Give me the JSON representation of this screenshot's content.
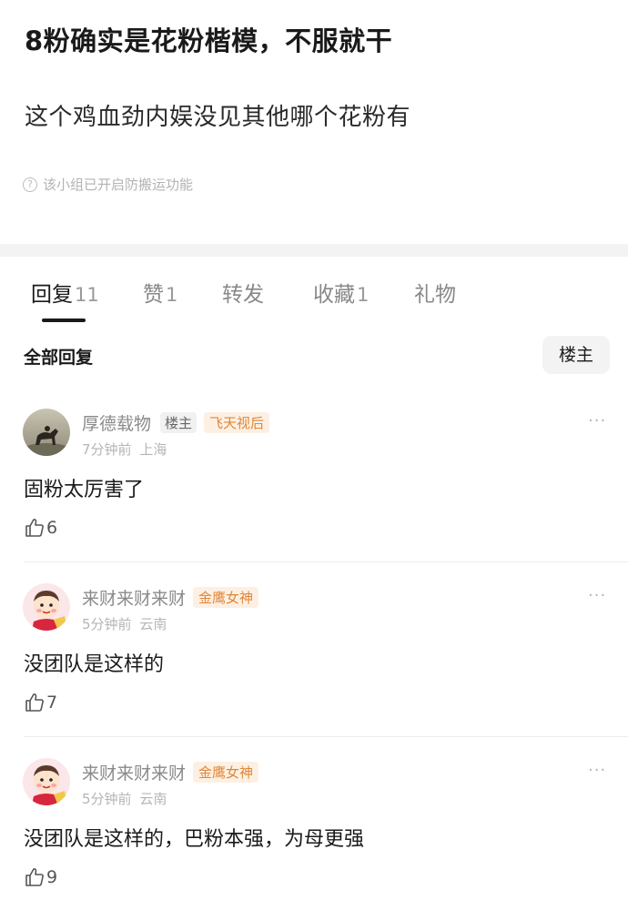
{
  "post": {
    "title": "8粉确实是花粉楷模，不服就干",
    "body": "这个鸡血劲内娱没见其他哪个花粉有",
    "notice": "该小组已开启防搬运功能"
  },
  "tabs": [
    {
      "label": "回复",
      "count": "11"
    },
    {
      "label": "赞",
      "count": "1"
    },
    {
      "label": "转发",
      "count": ""
    },
    {
      "label": "收藏",
      "count": "1"
    },
    {
      "label": "礼物",
      "count": ""
    }
  ],
  "replies_header": {
    "title": "全部回复",
    "filter_label": "楼主"
  },
  "comments": [
    {
      "username": "厚德载物",
      "owner_badge": "楼主",
      "title_badge": "飞天视后",
      "time": "7分钟前",
      "location": "上海",
      "text": "固粉太厉害了",
      "likes": "6",
      "more": "···"
    },
    {
      "username": "来财来财来财",
      "title_badge": "金鹰女神",
      "time": "5分钟前",
      "location": "云南",
      "text": "没团队是这样的",
      "likes": "7",
      "more": "···"
    },
    {
      "username": "来财来财来财",
      "title_badge": "金鹰女神",
      "time": "5分钟前",
      "location": "云南",
      "text": "没团队是这样的，巴粉本强，为母更强",
      "likes": "9",
      "more": "···"
    }
  ]
}
